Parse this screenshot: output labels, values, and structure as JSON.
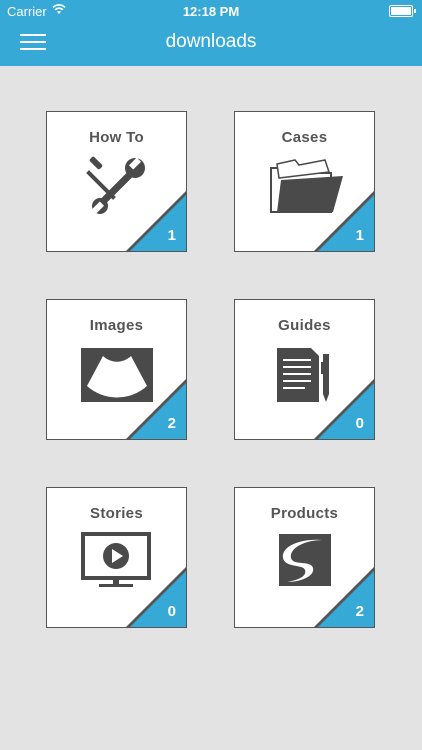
{
  "status_bar": {
    "carrier": "Carrier",
    "time": "12:18 PM"
  },
  "header": {
    "title": "downloads"
  },
  "tiles": [
    {
      "label": "How To",
      "count": "1",
      "icon": "wrench-screwdriver-icon"
    },
    {
      "label": "Cases",
      "count": "1",
      "icon": "folder-icon"
    },
    {
      "label": "Images",
      "count": "2",
      "icon": "ultrasound-image-icon"
    },
    {
      "label": "Guides",
      "count": "0",
      "icon": "document-pen-icon"
    },
    {
      "label": "Stories",
      "count": "0",
      "icon": "video-monitor-icon"
    },
    {
      "label": "Products",
      "count": "2",
      "icon": "brand-logo-icon"
    }
  ],
  "colors": {
    "accent": "#36a9d6",
    "tile_icon": "#4a4a4a",
    "background": "#e3e3e3"
  }
}
